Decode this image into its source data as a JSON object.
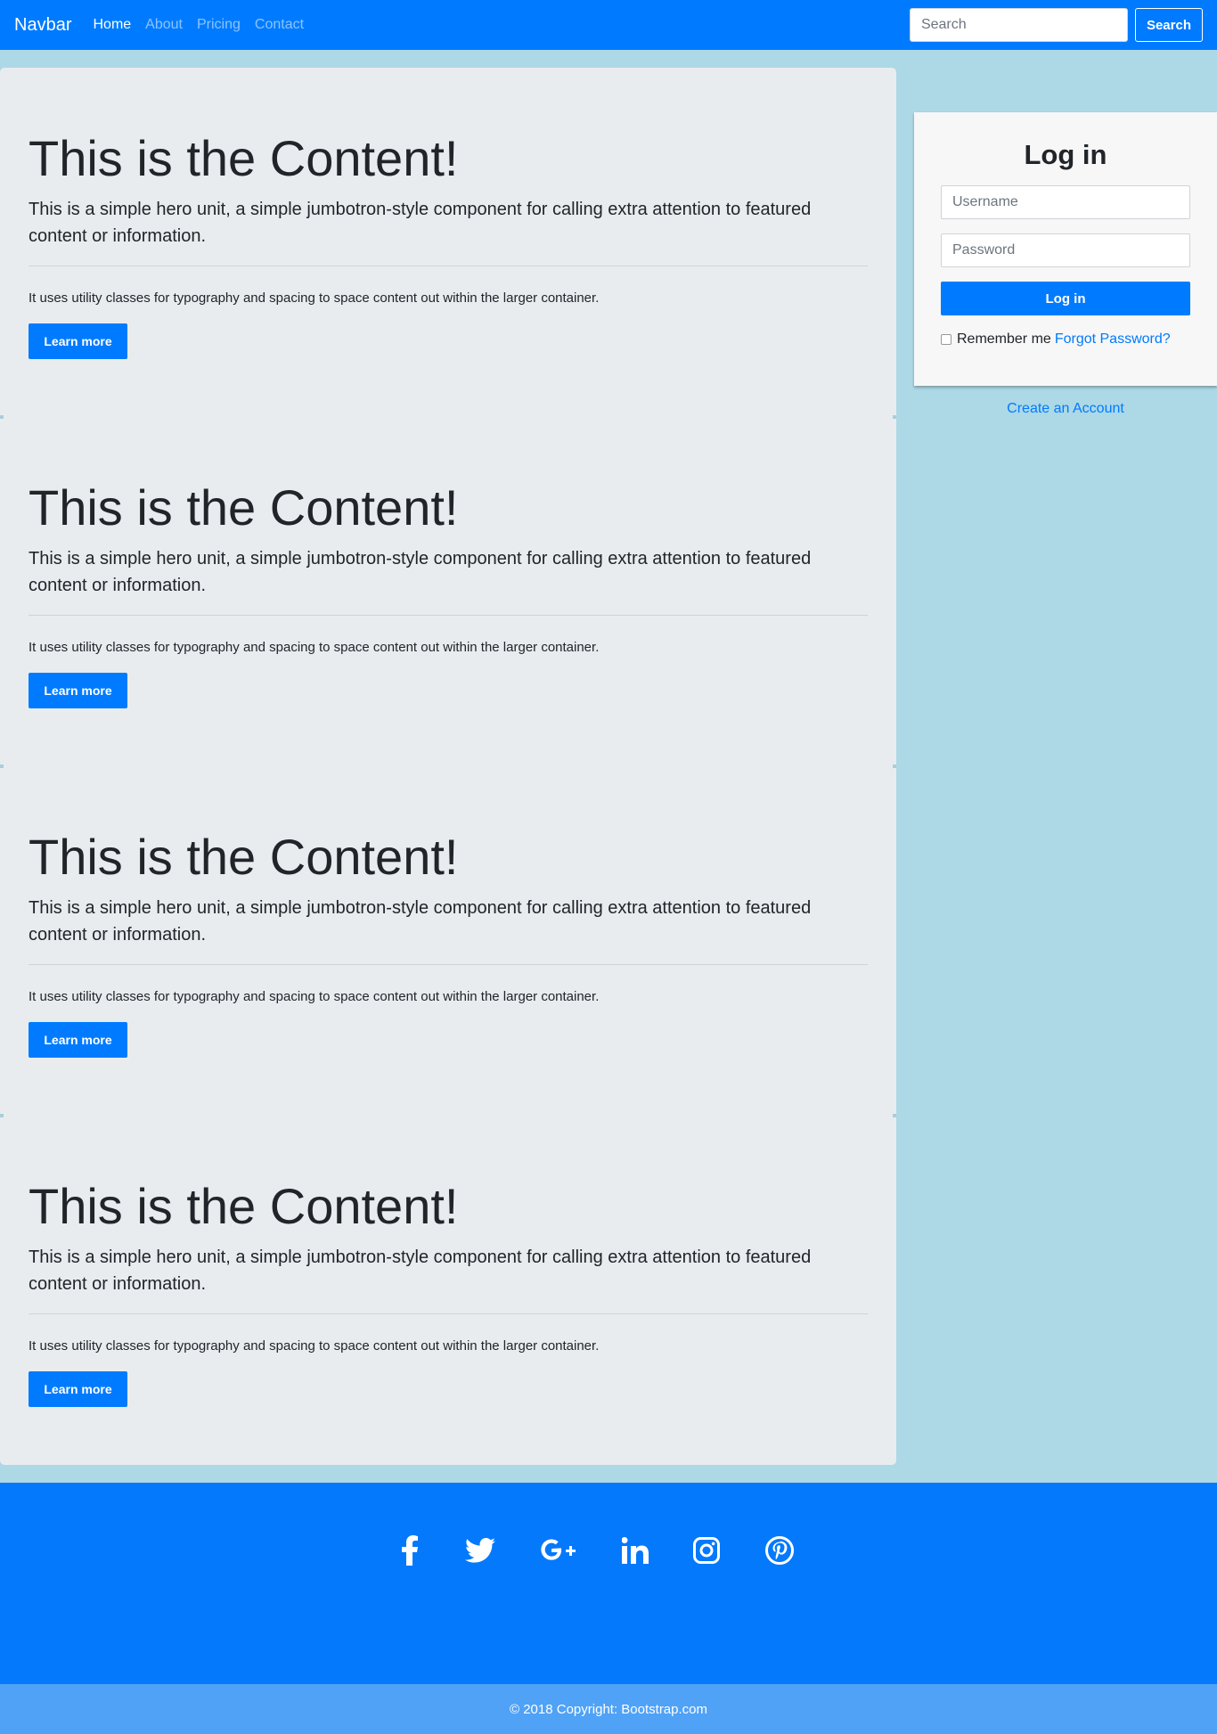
{
  "navbar": {
    "brand": "Navbar",
    "links": [
      {
        "label": "Home",
        "active": true
      },
      {
        "label": "About",
        "active": false
      },
      {
        "label": "Pricing",
        "active": false
      },
      {
        "label": "Contact",
        "active": false
      }
    ],
    "search_placeholder": "Search",
    "search_button": "Search"
  },
  "hero": {
    "title": "This is the Content!",
    "lead": "This is a simple hero unit, a simple jumbotron-style component for calling extra attention to featured content or information.",
    "text": "It uses utility classes for typography and spacing to space content out within the larger container.",
    "button": "Learn more",
    "repeat_count": 4
  },
  "login": {
    "title": "Log in",
    "username_placeholder": "Username",
    "password_placeholder": "Password",
    "button": "Log in",
    "remember": "Remember me",
    "forgot": "Forgot Password?",
    "create_account": "Create an Account"
  },
  "footer": {
    "social": [
      "facebook-icon",
      "twitter-icon",
      "google-plus-icon",
      "linkedin-icon",
      "instagram-icon",
      "pinterest-icon"
    ],
    "copyright": "© 2018 Copyright: Bootstrap.com"
  },
  "colors": {
    "primary": "#007bff",
    "page_bg": "#add8e6",
    "panel_bg": "#e9ecef",
    "footer_bg": "#0479fc",
    "copyright_bg": "#4fa2f6"
  }
}
